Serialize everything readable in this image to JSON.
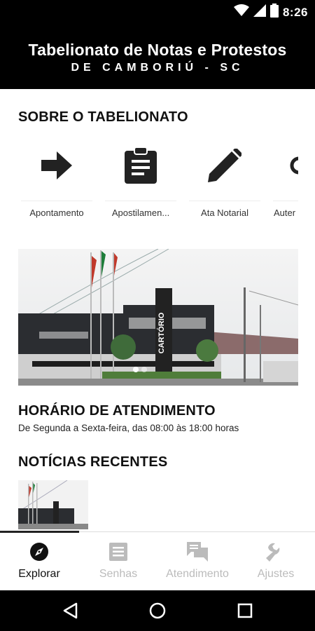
{
  "status_bar": {
    "time": "8:26",
    "icons": [
      "wifi-icon",
      "cellular-signal-icon",
      "battery-icon"
    ]
  },
  "header": {
    "title": "Tabelionato de Notas e Protestos",
    "subtitle": "DE CAMBORIÚ - SC"
  },
  "about": {
    "title": "SOBRE O TABELIONATO",
    "categories": [
      {
        "label": "Apontamento",
        "icon": "arrow-right-icon"
      },
      {
        "label": "Apostilamen...",
        "icon": "clipboard-icon"
      },
      {
        "label": "Ata Notarial",
        "icon": "pencil-icon"
      },
      {
        "label": "Auter",
        "icon": "partial-icon"
      }
    ]
  },
  "banner": {
    "sign_text": "CARTÓRIO"
  },
  "hours": {
    "title": "HORÁRIO DE ATENDIMENTO",
    "text": "De Segunda a Sexta-feira, das 08:00 às 18:00 horas"
  },
  "news": {
    "title": "NOTÍCIAS RECENTES"
  },
  "bottom_nav": {
    "active_index": 0,
    "items": [
      {
        "label": "Explorar",
        "icon": "compass-icon"
      },
      {
        "label": "Senhas",
        "icon": "list-icon"
      },
      {
        "label": "Atendimento",
        "icon": "chat-icon"
      },
      {
        "label": "Ajustes",
        "icon": "wrench-icon"
      }
    ]
  },
  "colors": {
    "header_bg": "#000000",
    "active": "#111111",
    "inactive": "#bbbbbb",
    "icon": "#222222"
  }
}
